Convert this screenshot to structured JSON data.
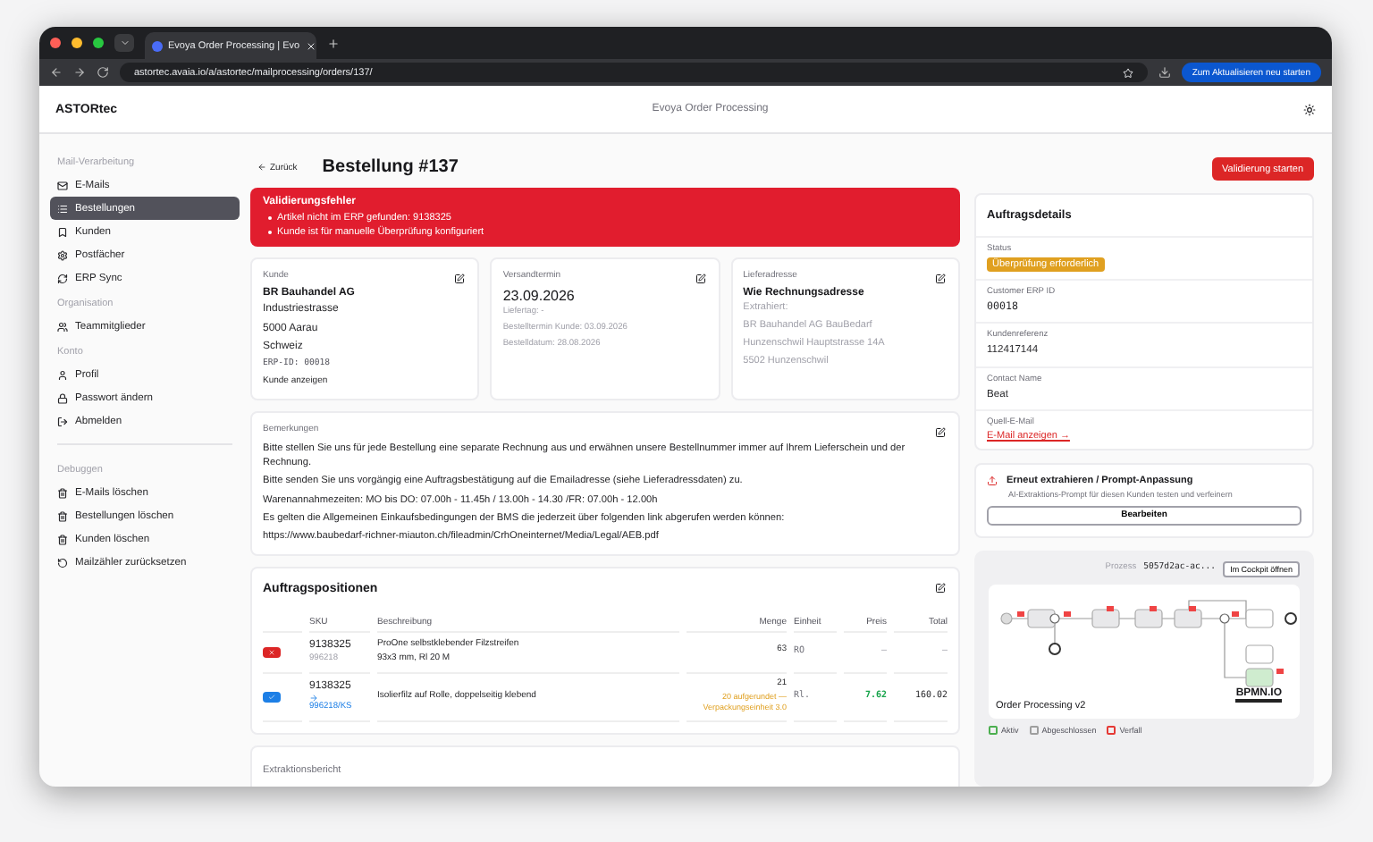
{
  "browser": {
    "tab_title": "Evoya Order Processing | Evo",
    "url": "astortec.avaia.io/a/astortec/mailprocessing/orders/137/",
    "update_button": "Zum Aktualisieren neu starten"
  },
  "header": {
    "brand": "ASTORtec",
    "title": "Evoya Order Processing"
  },
  "sidebar": [
    {
      "heading": "Mail-Verarbeitung",
      "items": [
        {
          "label": "E-Mails",
          "selected": false
        },
        {
          "label": "Bestellungen",
          "selected": true
        },
        {
          "label": "Kunden",
          "selected": false
        },
        {
          "label": "Postfächer",
          "selected": false
        },
        {
          "label": "ERP Sync",
          "selected": false
        }
      ]
    },
    {
      "heading": "Organisation",
      "items": [
        {
          "label": "Teammitglieder",
          "selected": false
        }
      ]
    },
    {
      "heading": "Konto",
      "items": [
        {
          "label": "Profil",
          "selected": false
        },
        {
          "label": "Passwort ändern",
          "selected": false
        },
        {
          "label": "Abmelden",
          "selected": false
        }
      ]
    },
    {
      "heading": "Debuggen",
      "items": [
        {
          "label": "E-Mails löschen",
          "selected": false
        },
        {
          "label": "Bestellungen löschen",
          "selected": false
        },
        {
          "label": "Kunden löschen",
          "selected": false
        },
        {
          "label": "Mailzähler zurücksetzen",
          "selected": false
        }
      ]
    }
  ],
  "page": {
    "back": "Zurück",
    "title": "Bestellung #137",
    "validate_button": "Validierung starten"
  },
  "error": {
    "title": "Validierungsfehler",
    "items": [
      "Artikel nicht im ERP gefunden: 9138325",
      "Kunde ist für manuelle Überprüfung konfiguriert"
    ]
  },
  "customer": {
    "label": "Kunde",
    "name": "BR Bauhandel AG",
    "lines": [
      "Industriestrasse",
      "5000 Aarau",
      "Schweiz"
    ],
    "erp_id": "ERP-ID: 00018",
    "link": "Kunde anzeigen"
  },
  "shipping": {
    "label": "Versandtermin",
    "date": "23.09.2026",
    "lines": [
      "Liefertag: -",
      "Bestelltermin Kunde: 03.09.2026",
      "Bestelldatum: 28.08.2026"
    ]
  },
  "delivery": {
    "label": "Lieferadresse",
    "name": "Wie Rechnungsadresse",
    "extracted_label": "Extrahiert:",
    "lines": [
      "BR Bauhandel AG BauBedarf",
      "Hunzenschwil Hauptstrasse 14A",
      "5502 Hunzenschwil"
    ]
  },
  "remarks": {
    "label": "Bemerkungen",
    "lines": [
      "Bitte stellen Sie uns für jede Bestellung eine separate Rechnung aus und erwähnen unsere Bestellnummer immer auf Ihrem Lieferschein und der Rechnung.",
      "Bitte senden Sie uns vorgängig eine Auftragsbestätigung auf die Emailadresse (siehe Lieferadressdaten) zu.",
      "Warenannahmezeiten: MO bis DO: 07.00h - 11.45h / 13.00h - 14.30 /FR: 07.00h - 12.00h",
      "Es gelten die Allgemeinen Einkaufsbedingungen der BMS die jederzeit über folgenden link abgerufen werden können:",
      "https://www.baubedarf-richner-miauton.ch/fileadmin/CrhOneinternet/Media/Legal/AEB.pdf"
    ]
  },
  "positions": {
    "title": "Auftragspositionen",
    "columns": [
      "SKU",
      "Beschreibung",
      "Menge",
      "Einheit",
      "Preis",
      "Total"
    ],
    "rows": [
      {
        "kind": "error",
        "sku": "9138325",
        "sku_sub": "996218",
        "mapped": false,
        "description": "ProOne selbstklebender Filzstreifen 93x3 mm, Rl 20 M",
        "qty": "63",
        "qty_note": "",
        "unit": "RO",
        "price": "–",
        "total": "–"
      },
      {
        "kind": "ok",
        "sku": "9138325",
        "sku_sub": "996218/KS",
        "mapped": true,
        "description": "Isolierfilz auf Rolle, doppelseitig klebend",
        "qty": "21",
        "qty_note": "20 aufgerundet — Verpackungseinheit 3.0",
        "unit": "Rl.",
        "price": "7.62",
        "total": "160.02"
      }
    ]
  },
  "extraction": {
    "title": "Extraktionsbericht"
  },
  "details": {
    "title": "Auftragsdetails",
    "fields": [
      {
        "label": "Status",
        "value": "Überprüfung erforderlich",
        "kind": "badge"
      },
      {
        "label": "Customer ERP ID",
        "value": "00018",
        "kind": "mono"
      },
      {
        "label": "Kundenreferenz",
        "value": "112417144",
        "kind": "text"
      },
      {
        "label": "Contact Name",
        "value": "Beat",
        "kind": "text"
      },
      {
        "label": "Quell-E-Mail",
        "value": "E-Mail anzeigen →",
        "kind": "link"
      }
    ]
  },
  "reextract": {
    "title": "Erneut extrahieren / Prompt-Anpassung",
    "description": "AI-Extraktions-Prompt für diesen Kunden testen und verfeinern",
    "button": "Bearbeiten"
  },
  "process": {
    "label": "Prozess",
    "id": "5057d2ac-ac...",
    "button": "Im Cockpit öffnen",
    "diagram_title": "Order Processing v2",
    "logo": "BPMN.IO",
    "legend": [
      {
        "label": "Aktiv",
        "color": "#4caf50"
      },
      {
        "label": "Abgeschlossen",
        "color": "#9e9e9e"
      },
      {
        "label": "Verfall",
        "color": "#e53935"
      }
    ]
  }
}
